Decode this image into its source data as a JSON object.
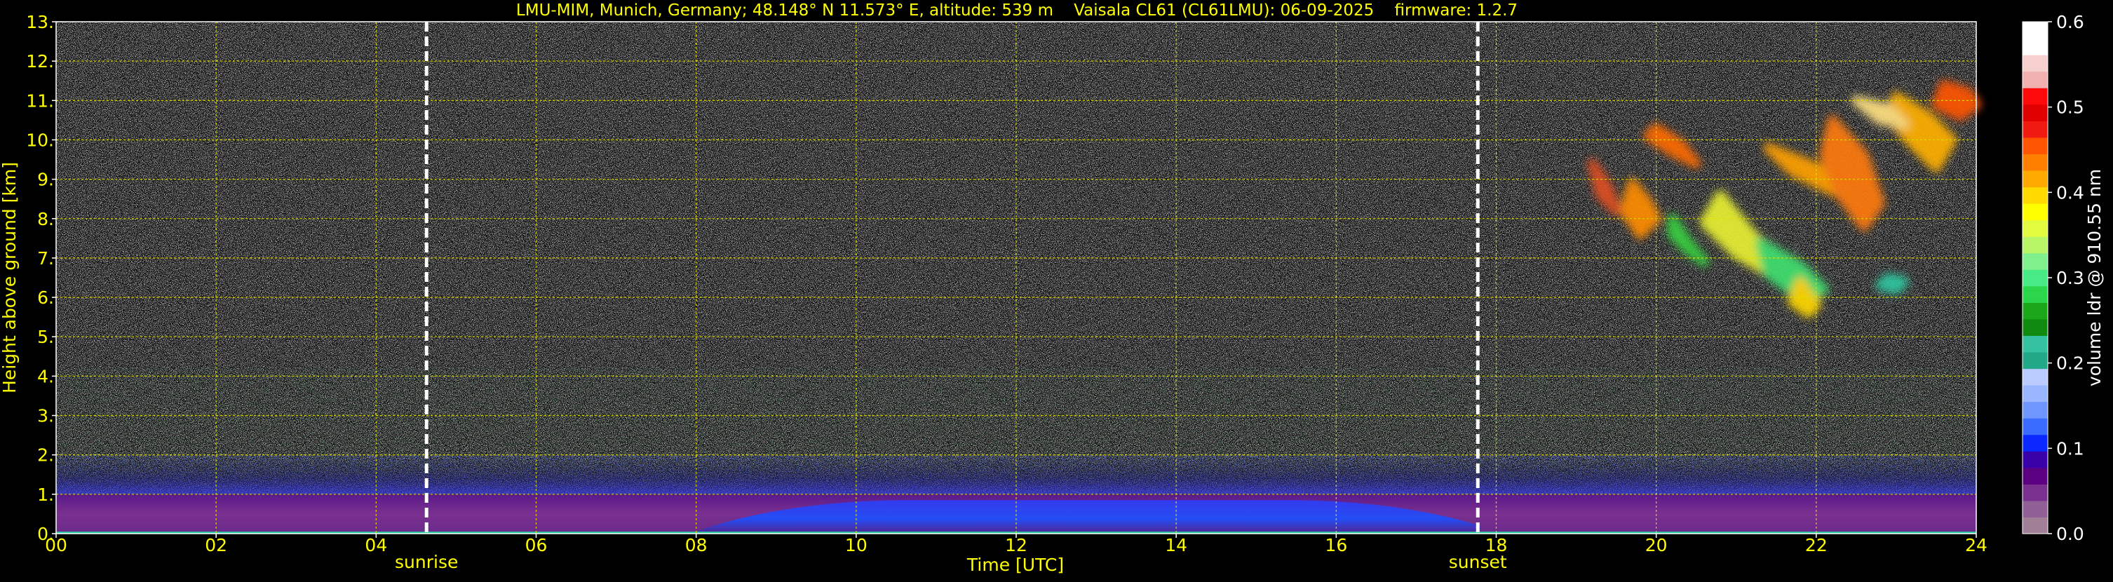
{
  "colors": {
    "background": "#000000",
    "text": "#ffff00",
    "grid": "#e0e000",
    "marker_line": "#ffffff",
    "cbar_text": "#ffffff"
  },
  "chart_data": {
    "type": "heatmap",
    "title": "LMU-MIM, Munich, Germany; 48.148° N 11.573° E, altitude: 539 m    Vaisala CL61 (CL61LMU): 06-09-2025    firmware: 1.2.7",
    "xlabel": "Time [UTC]",
    "ylabel": "Height above ground [km]",
    "xlim": [
      0,
      24
    ],
    "ylim": [
      0,
      13
    ],
    "x_ticks": [
      "00",
      "02",
      "04",
      "06",
      "08",
      "10",
      "12",
      "14",
      "16",
      "18",
      "20",
      "22",
      "24"
    ],
    "y_ticks": [
      "0.",
      "1.",
      "2.",
      "3.",
      "4.",
      "5.",
      "6.",
      "7.",
      "8.",
      "9.",
      "10.",
      "11.",
      "12.",
      "13."
    ],
    "grid": true,
    "markers": [
      {
        "label": "sunrise",
        "x": 4.63
      },
      {
        "label": "sunset",
        "x": 17.77
      }
    ],
    "colorbar": {
      "label": "volume ldr @ 910.55 nm",
      "range": [
        0.0,
        0.6
      ],
      "ticks": [
        "0.0",
        "0.1",
        "0.2",
        "0.3",
        "0.4",
        "0.5",
        "0.6"
      ],
      "colors": [
        "#a07f97",
        "#8f5f96",
        "#7a308f",
        "#5c0082",
        "#3a00a8",
        "#0a28ff",
        "#3a6cff",
        "#6f95ff",
        "#9ab6ff",
        "#b9cbff",
        "#22a887",
        "#35c2a0",
        "#118a10",
        "#1aa81a",
        "#2bd64a",
        "#48ea86",
        "#7ff08c",
        "#b8f567",
        "#e3fb3f",
        "#ffff00",
        "#ffd900",
        "#ffaa00",
        "#ff8000",
        "#ff5500",
        "#f01a10",
        "#e00000",
        "#ff0a0a",
        "#f0b0b0",
        "#f5d0cf",
        "#ffffff",
        "#ffffff"
      ]
    },
    "layers": [
      {
        "name": "boundary layer low ldr",
        "x_range": [
          0,
          24
        ],
        "y_range": [
          0,
          1.0
        ],
        "value": 0.04
      },
      {
        "name": "day aerosol layer",
        "x_range": [
          8,
          17.8
        ],
        "y_range": [
          0,
          0.9
        ],
        "value": 0.08
      },
      {
        "name": "noisy mid layer",
        "x_range": [
          0,
          24
        ],
        "y_range": [
          1.0,
          4.0
        ],
        "value": 0.15
      },
      {
        "name": "noise",
        "x_range": [
          0,
          24
        ],
        "y_range": [
          4.0,
          13.0
        ],
        "value": 0.3
      },
      {
        "name": "cirrus cloud",
        "x_range": [
          18.8,
          24
        ],
        "y_range": [
          5.6,
          11.5
        ],
        "value": 0.38
      }
    ]
  }
}
